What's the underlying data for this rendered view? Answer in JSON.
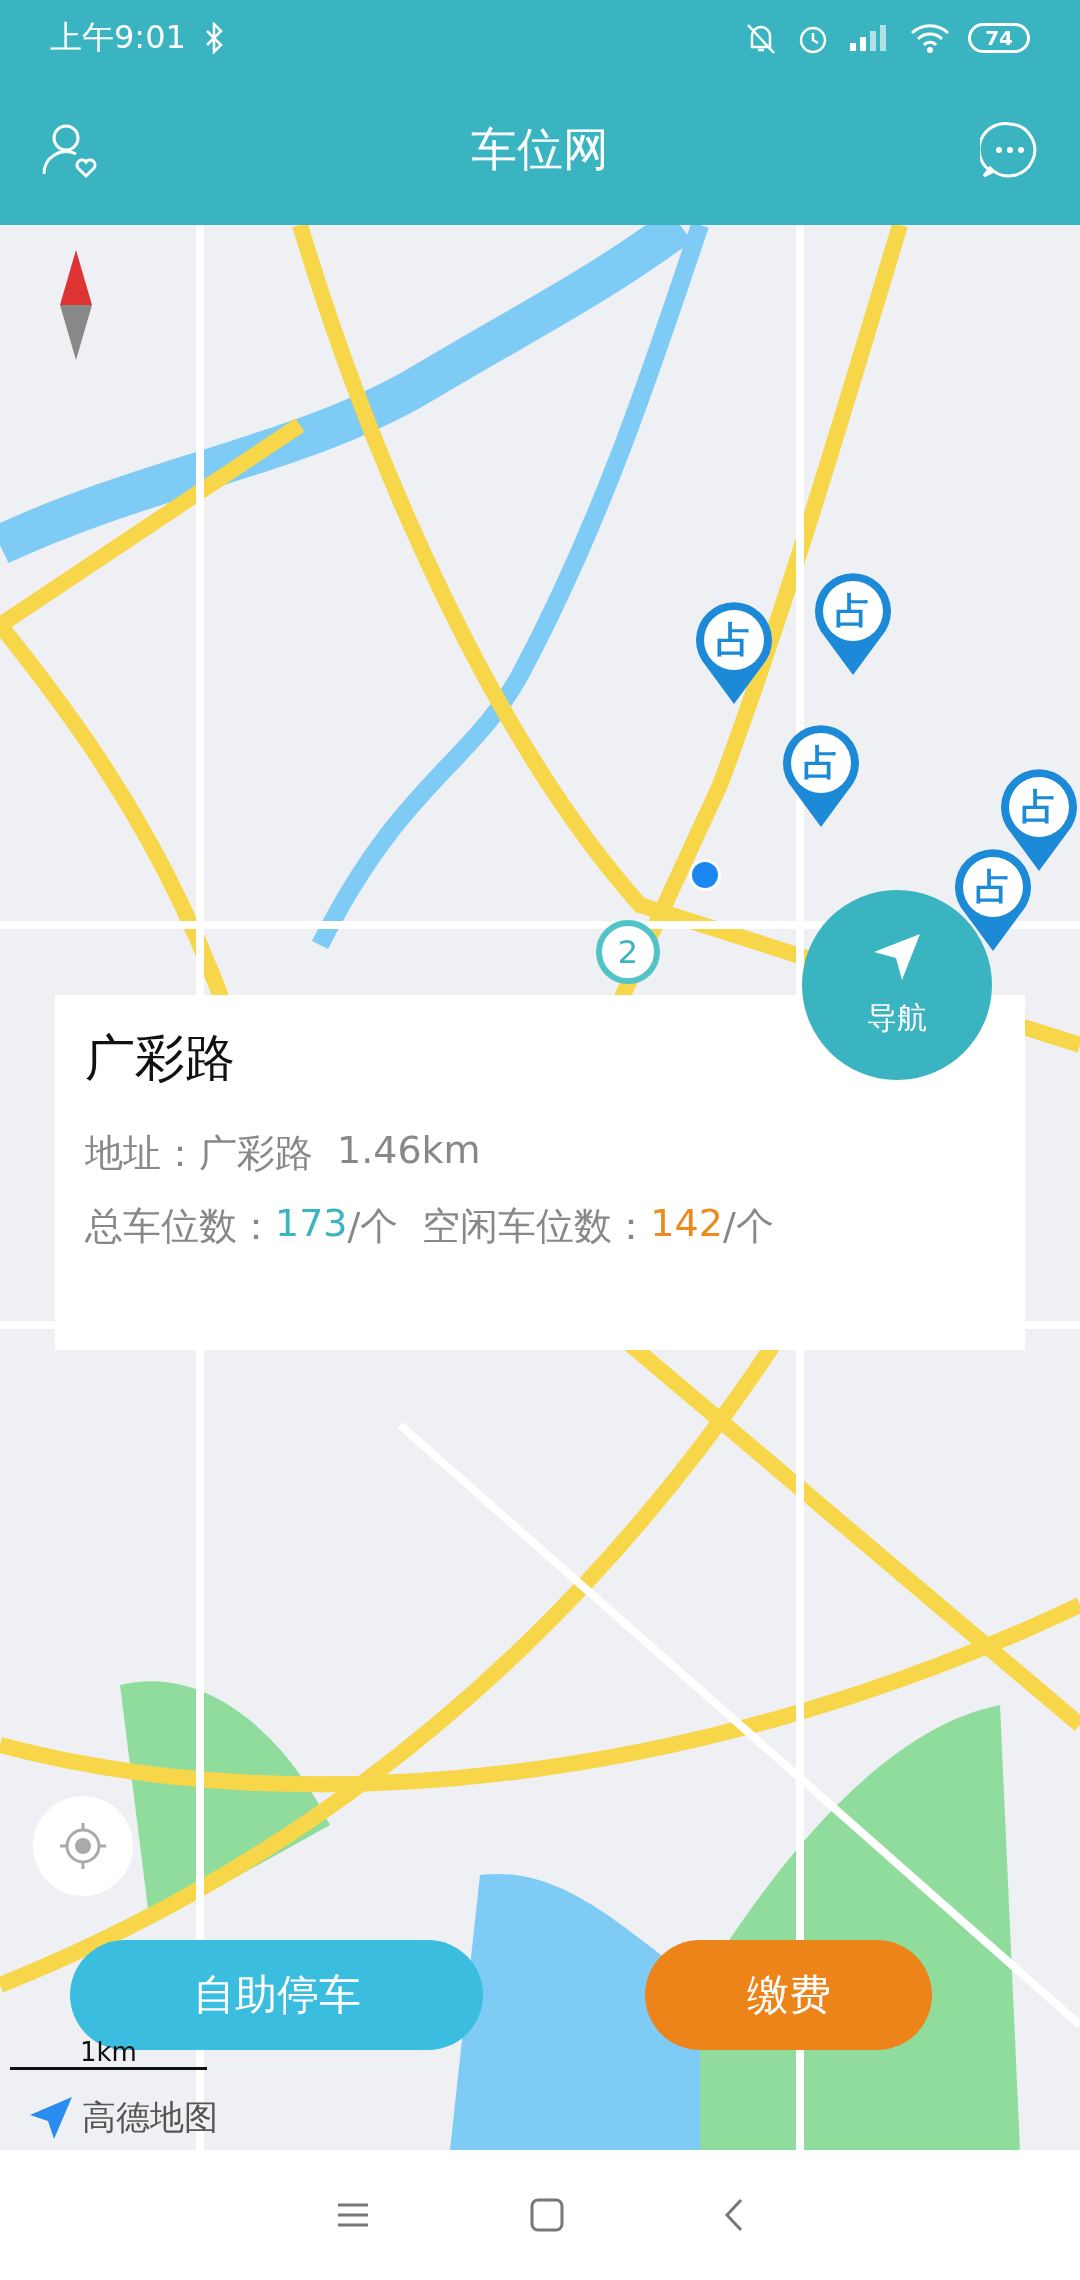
{
  "status_bar": {
    "time": "上午9:01",
    "battery": "74"
  },
  "header": {
    "title": "车位网"
  },
  "map": {
    "pins": [
      {
        "label": "占"
      },
      {
        "label": "占"
      },
      {
        "label": "占"
      },
      {
        "label": "占"
      },
      {
        "label": "占"
      }
    ],
    "cluster": {
      "count": "2"
    },
    "scale": "1km",
    "logo": "高德地图"
  },
  "card": {
    "title": "广彩路",
    "address_label": "地址：",
    "address": "广彩路",
    "distance": "1.46km",
    "total_label": "总车位数：",
    "total": "173",
    "total_unit": "/个",
    "free_label": "空闲车位数：",
    "free": "142",
    "free_unit": "/个"
  },
  "nav_button": {
    "label": "导航"
  },
  "buttons": [
    {
      "kind": "primary",
      "label": "自助停车"
    },
    {
      "kind": "pay",
      "label": "缴费"
    }
  ]
}
